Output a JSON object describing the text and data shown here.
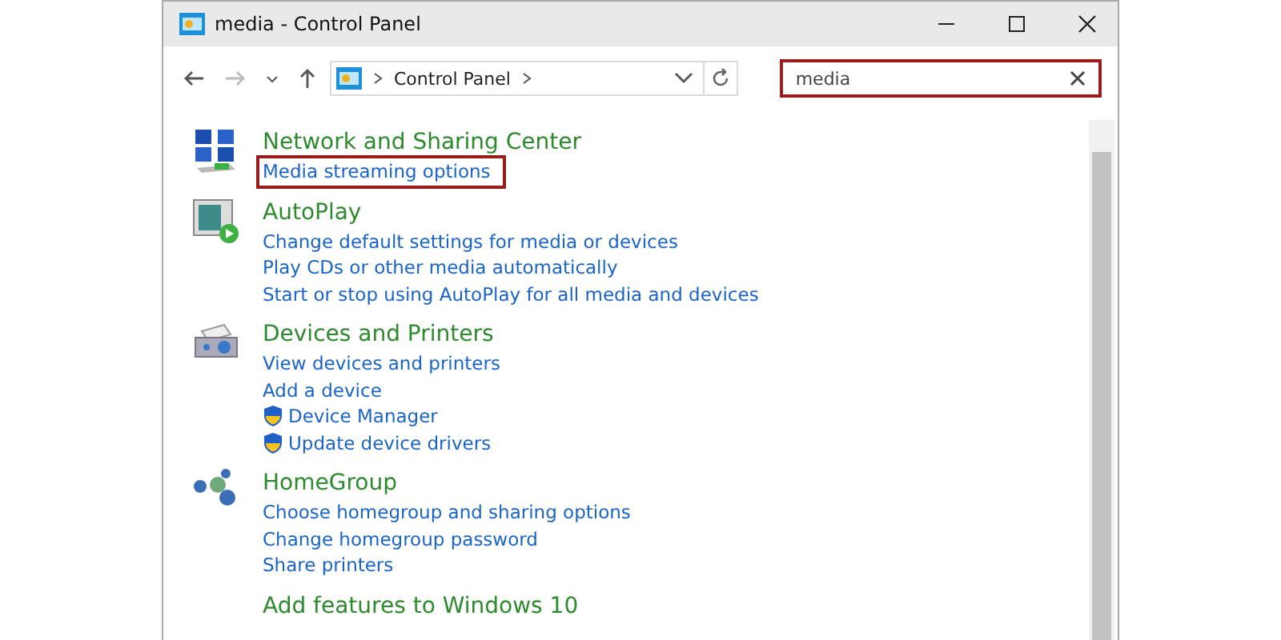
{
  "window": {
    "title": "media - Control Panel"
  },
  "address_bar": {
    "breadcrumb": "Control Panel"
  },
  "search": {
    "value": "media",
    "highlighted": true
  },
  "sections": [
    {
      "kind": "network",
      "title": "Network and Sharing Center",
      "links": [
        {
          "text": "Media streaming options",
          "shield": false,
          "highlighted": true
        }
      ]
    },
    {
      "kind": "autoplay",
      "title": "AutoPlay",
      "links": [
        {
          "text": "Change default settings for media or devices",
          "shield": false,
          "highlighted": false
        },
        {
          "text": "Play CDs or other media automatically",
          "shield": false,
          "highlighted": false
        },
        {
          "text": "Start or stop using AutoPlay for all media and devices",
          "shield": false,
          "highlighted": false
        }
      ]
    },
    {
      "kind": "devices",
      "title": "Devices and Printers",
      "links": [
        {
          "text": "View devices and printers",
          "shield": false,
          "highlighted": false
        },
        {
          "text": "Add a device",
          "shield": false,
          "highlighted": false
        },
        {
          "text": "Device Manager",
          "shield": true,
          "highlighted": false
        },
        {
          "text": "Update device drivers",
          "shield": true,
          "highlighted": false
        }
      ]
    },
    {
      "kind": "homegroup",
      "title": "HomeGroup",
      "links": [
        {
          "text": "Choose homegroup and sharing options",
          "shield": false,
          "highlighted": false
        },
        {
          "text": "Change homegroup password",
          "shield": false,
          "highlighted": false
        },
        {
          "text": "Share printers",
          "shield": false,
          "highlighted": false
        }
      ]
    },
    {
      "kind": "features",
      "title": "Add features to Windows 10"
    }
  ]
}
